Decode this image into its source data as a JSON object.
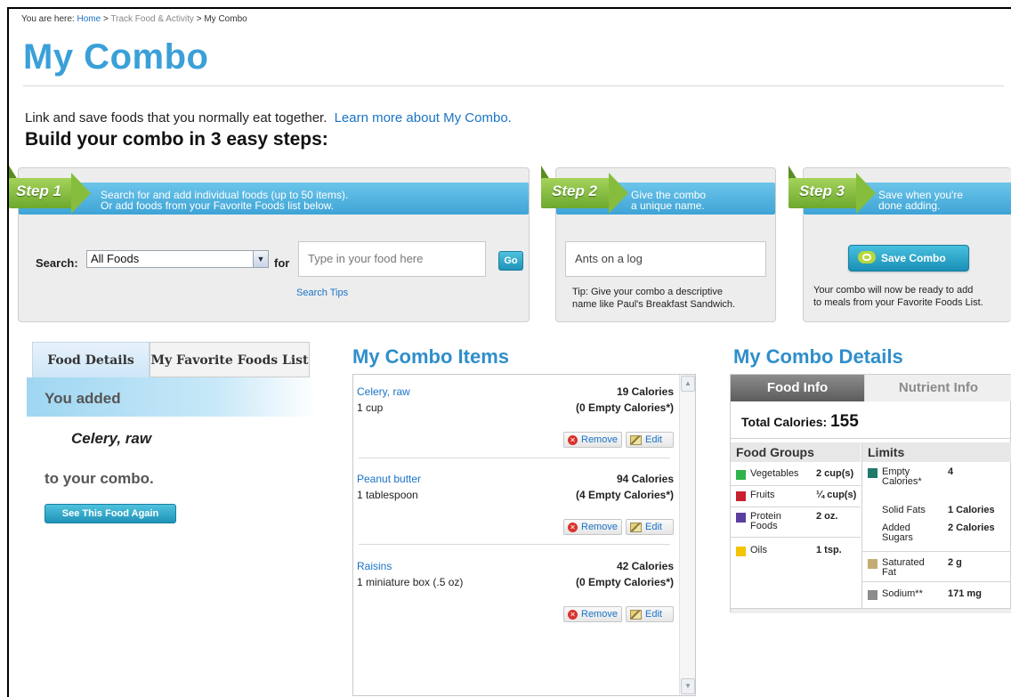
{
  "breadcrumb": {
    "prefix": "You are here:",
    "home": "Home",
    "sep1": ">",
    "track": "Track Food & Activity",
    "sep2": ">",
    "current": "My Combo"
  },
  "page_title": "My Combo",
  "intro": {
    "text": "Link and save foods that you normally eat together.",
    "link": "Learn more about My Combo."
  },
  "headline": "Build your combo in 3 easy steps:",
  "step1": {
    "badge": "Step 1",
    "line1": "Search for and add individual foods (up to 50 items).",
    "line2": "Or add foods from your Favorite Foods list below.",
    "search_label": "Search:",
    "category": "All Foods",
    "for_label": "for",
    "placeholder": "Type in your food here",
    "go": "Go",
    "tips": "Search Tips"
  },
  "step2": {
    "badge": "Step 2",
    "line1": "Give the combo",
    "line2": "a unique name.",
    "name_value": "Ants on a log",
    "tip_line1": "Tip: Give your combo a descriptive",
    "tip_line2": "name like Paul's Breakfast Sandwich."
  },
  "step3": {
    "badge": "Step 3",
    "line1": "Save when you're",
    "line2": "done adding.",
    "save": "Save Combo",
    "note_line1": "Your combo will now be ready to add",
    "note_line2": "to meals from your Favorite Foods List."
  },
  "left_tabs": {
    "food_details": "Food Details",
    "favorites": "My Favorite Foods List"
  },
  "added": {
    "you_added": "You added",
    "food": "Celery, raw",
    "to_combo": "to your combo.",
    "see_again": "See This Food Again"
  },
  "items_title": "My Combo Items",
  "items": [
    {
      "name": "Celery, raw",
      "portion": "1 cup",
      "calories": "19 Calories",
      "empty": "(0 Empty Calories*)",
      "remove": "Remove",
      "edit": "Edit"
    },
    {
      "name": "Peanut butter",
      "portion": "1 tablespoon",
      "calories": "94 Calories",
      "empty": "(4 Empty Calories*)",
      "remove": "Remove",
      "edit": "Edit"
    },
    {
      "name": "Raisins",
      "portion": "1 miniature box (.5 oz)",
      "calories": "42 Calories",
      "empty": "(0 Empty Calories*)",
      "remove": "Remove",
      "edit": "Edit"
    }
  ],
  "details_title": "My Combo Details",
  "details": {
    "tab_food": "Food Info",
    "tab_nutrient": "Nutrient Info",
    "total_label": "Total Calories:",
    "total_value": "155",
    "groups_head": "Food Groups",
    "limits_head": "Limits",
    "groups": [
      {
        "label": "Vegetables",
        "value": "2 cup(s)",
        "color": "#2fb24c"
      },
      {
        "label": "Fruits",
        "value": "¼ cup(s)",
        "color": "#c8202f"
      },
      {
        "label": "Protein Foods",
        "value": "2 oz.",
        "color": "#5b3fa0"
      },
      {
        "label": "Oils",
        "value": "1 tsp.",
        "color": "#f5c400"
      }
    ],
    "limits": [
      {
        "label": "Empty Calories*",
        "value": "4",
        "color": "#1f7a6a"
      },
      {
        "label": "Solid Fats",
        "value": "1 Calories"
      },
      {
        "label": "Added Sugars",
        "value": "2 Calories"
      },
      {
        "label": "Saturated Fat",
        "value": "2 g",
        "color": "#c4ac74"
      },
      {
        "label": "Sodium**",
        "value": "171 mg",
        "color": "#8c8c8c"
      }
    ]
  }
}
